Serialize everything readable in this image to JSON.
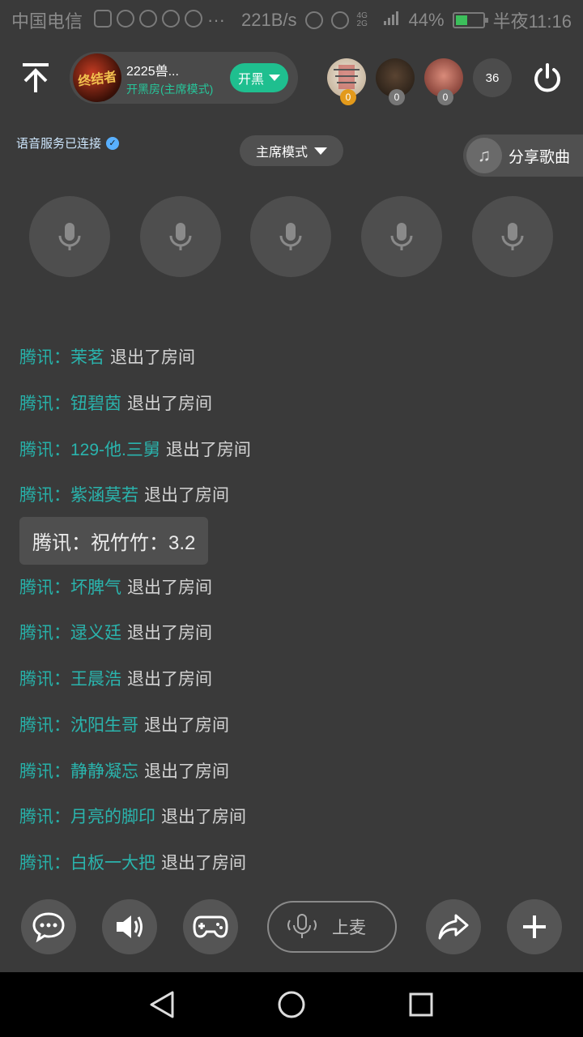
{
  "status_bar": {
    "carrier": "中国电信",
    "net_speed": "221B/s",
    "network": "4G 2G",
    "battery": "44%",
    "time": "半夜11:16"
  },
  "header": {
    "room_title": "2225兽...",
    "room_subtitle": "开黑房(主席模式)",
    "room_avatar_text": "终结者",
    "open_black_label": "开黑",
    "audience": [
      {
        "badge": "0",
        "color": "#d9cfc0"
      },
      {
        "badge": "0",
        "color": "#3d2f22"
      },
      {
        "badge": "0",
        "color": "#b2574a"
      }
    ],
    "audience_count": "36"
  },
  "info": {
    "voice_status": "语音服务已连接",
    "mode_label": "主席模式",
    "share_song_label": "分享歌曲"
  },
  "seats": [
    {},
    {},
    {},
    {},
    {}
  ],
  "chat": {
    "messages": [
      {
        "source": "腾讯：",
        "user": "茉茗",
        "action": "退出了房间"
      },
      {
        "source": "腾讯：",
        "user": "钮碧茵",
        "action": "退出了房间"
      },
      {
        "source": "腾讯：",
        "user": "129-他.三舅",
        "action": "退出了房间"
      },
      {
        "source": "腾讯：",
        "user": "紫涵莫若",
        "action": "退出了房间"
      },
      {
        "bubble": "腾讯：祝竹竹：3.2"
      },
      {
        "source": "腾讯：",
        "user": "坏脾气",
        "action": "退出了房间"
      },
      {
        "source": "腾讯：",
        "user": "逯义廷",
        "action": "退出了房间"
      },
      {
        "source": "腾讯：",
        "user": "王晨浩",
        "action": "退出了房间"
      },
      {
        "source": "腾讯：",
        "user": "沈阳生哥",
        "action": "退出了房间"
      },
      {
        "source": "腾讯：",
        "user": "静静凝忘",
        "action": "退出了房间"
      },
      {
        "source": "腾讯：",
        "user": "月亮的脚印",
        "action": "退出了房间"
      },
      {
        "source": "腾讯：",
        "user": "白板一大把",
        "action": "退出了房间"
      }
    ]
  },
  "toolbar": {
    "mic_up_label": "上麦"
  },
  "colors": {
    "accent": "#1fbf8f",
    "chat_name": "#2ab4ad",
    "background": "#3a3a3a"
  }
}
